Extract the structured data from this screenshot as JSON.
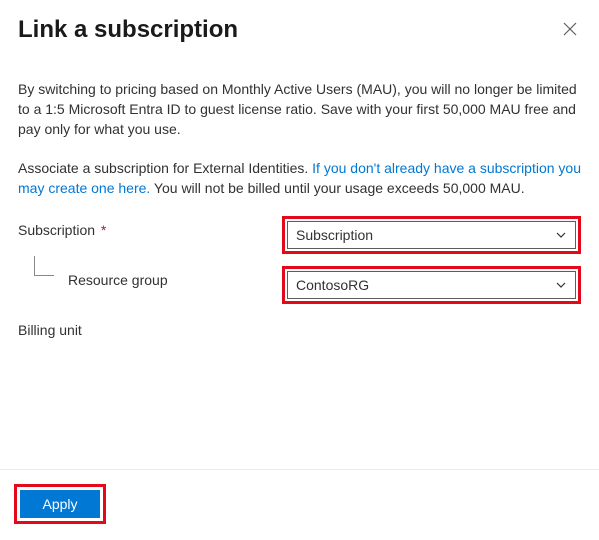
{
  "header": {
    "title": "Link a subscription"
  },
  "body": {
    "intro": "By switching to pricing based on Monthly Active Users (MAU), you will no longer be limited to a 1:5 Microsoft Entra ID to guest license ratio. Save with your first 50,000 MAU free and pay only for what you use.",
    "assoc_prefix": "Associate a subscription for External Identities. ",
    "assoc_link": "If you don't already have a subscription you may create one here.",
    "assoc_suffix": " You will not be billed until your usage exceeds 50,000 MAU."
  },
  "form": {
    "subscription_label": "Subscription",
    "subscription_value": "Subscription",
    "resource_group_label": "Resource group",
    "resource_group_value": "ContosoRG",
    "billing_unit_label": "Billing unit"
  },
  "footer": {
    "apply_label": "Apply"
  }
}
